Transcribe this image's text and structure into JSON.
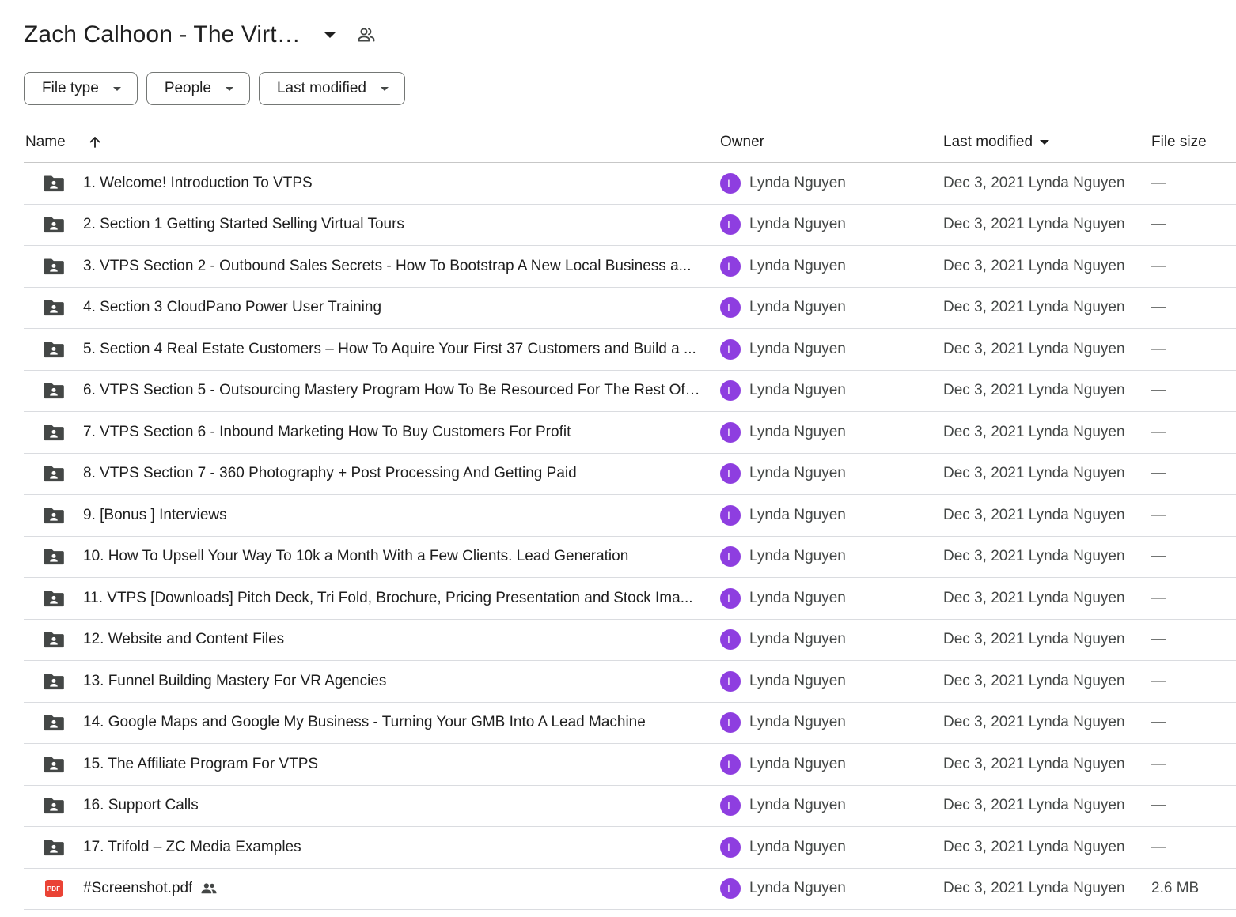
{
  "header": {
    "title": "Zach Calhoon - The Virt…",
    "title_icon": "chevron-down-icon",
    "shared_icon": "shared-with-people-icon"
  },
  "filters": [
    {
      "label": "File type"
    },
    {
      "label": "People"
    },
    {
      "label": "Last modified"
    }
  ],
  "table": {
    "columns": {
      "name": "Name",
      "owner": "Owner",
      "last_modified": "Last modified",
      "file_size": "File size"
    },
    "sort_icon": "arrow-up-icon",
    "avatar_color": "#8e3ee0",
    "rows": [
      {
        "type": "shared-folder",
        "name": "1. Welcome! Introduction To VTPS",
        "avatar": "L",
        "owner": "Lynda Nguyen",
        "modified": "Dec 3, 2021 Lynda Nguyen",
        "size": "—"
      },
      {
        "type": "shared-folder",
        "name": "2. Section 1 Getting Started Selling Virtual Tours",
        "avatar": "L",
        "owner": "Lynda Nguyen",
        "modified": "Dec 3, 2021 Lynda Nguyen",
        "size": "—"
      },
      {
        "type": "shared-folder",
        "name": "3. VTPS Section 2 - Outbound Sales Secrets - How To Bootstrap A New Local Business a...",
        "avatar": "L",
        "owner": "Lynda Nguyen",
        "modified": "Dec 3, 2021 Lynda Nguyen",
        "size": "—"
      },
      {
        "type": "shared-folder",
        "name": "4. Section 3 CloudPano Power User Training",
        "avatar": "L",
        "owner": "Lynda Nguyen",
        "modified": "Dec 3, 2021 Lynda Nguyen",
        "size": "—"
      },
      {
        "type": "shared-folder",
        "name": "5. Section 4 Real Estate Customers – How To Aquire Your First 37 Customers and Build a ...",
        "avatar": "L",
        "owner": "Lynda Nguyen",
        "modified": "Dec 3, 2021 Lynda Nguyen",
        "size": "—"
      },
      {
        "type": "shared-folder",
        "name": "6. VTPS Section 5 - Outsourcing Mastery Program How To Be Resourced For The Rest Of ...",
        "avatar": "L",
        "owner": "Lynda Nguyen",
        "modified": "Dec 3, 2021 Lynda Nguyen",
        "size": "—"
      },
      {
        "type": "shared-folder",
        "name": "7. VTPS Section 6 - Inbound Marketing How To Buy Customers For Profit",
        "avatar": "L",
        "owner": "Lynda Nguyen",
        "modified": "Dec 3, 2021 Lynda Nguyen",
        "size": "—"
      },
      {
        "type": "shared-folder",
        "name": "8. VTPS Section 7 - 360 Photography + Post Processing And Getting Paid",
        "avatar": "L",
        "owner": "Lynda Nguyen",
        "modified": "Dec 3, 2021 Lynda Nguyen",
        "size": "—"
      },
      {
        "type": "shared-folder",
        "name": "9. [Bonus ] Interviews",
        "avatar": "L",
        "owner": "Lynda Nguyen",
        "modified": "Dec 3, 2021 Lynda Nguyen",
        "size": "—"
      },
      {
        "type": "shared-folder",
        "name": "10. How To Upsell Your Way To 10k a Month With a Few Clients. Lead Generation",
        "avatar": "L",
        "owner": "Lynda Nguyen",
        "modified": "Dec 3, 2021 Lynda Nguyen",
        "size": "—"
      },
      {
        "type": "shared-folder",
        "name": "11. VTPS [Downloads] Pitch Deck, Tri Fold, Brochure, Pricing Presentation and Stock Ima...",
        "avatar": "L",
        "owner": "Lynda Nguyen",
        "modified": "Dec 3, 2021 Lynda Nguyen",
        "size": "—"
      },
      {
        "type": "shared-folder",
        "name": "12. Website and Content Files",
        "avatar": "L",
        "owner": "Lynda Nguyen",
        "modified": "Dec 3, 2021 Lynda Nguyen",
        "size": "—"
      },
      {
        "type": "shared-folder",
        "name": "13. Funnel Building Mastery For VR Agencies",
        "avatar": "L",
        "owner": "Lynda Nguyen",
        "modified": "Dec 3, 2021 Lynda Nguyen",
        "size": "—"
      },
      {
        "type": "shared-folder",
        "name": "14. Google Maps and Google My Business - Turning Your GMB Into A Lead Machine",
        "avatar": "L",
        "owner": "Lynda Nguyen",
        "modified": "Dec 3, 2021 Lynda Nguyen",
        "size": "—"
      },
      {
        "type": "shared-folder",
        "name": "15. The Affiliate Program For VTPS",
        "avatar": "L",
        "owner": "Lynda Nguyen",
        "modified": "Dec 3, 2021 Lynda Nguyen",
        "size": "—"
      },
      {
        "type": "shared-folder",
        "name": "16. Support Calls",
        "avatar": "L",
        "owner": "Lynda Nguyen",
        "modified": "Dec 3, 2021 Lynda Nguyen",
        "size": "—"
      },
      {
        "type": "shared-folder",
        "name": "17. Trifold – ZC Media Examples",
        "avatar": "L",
        "owner": "Lynda Nguyen",
        "modified": "Dec 3, 2021 Lynda Nguyen",
        "size": "—"
      },
      {
        "type": "pdf",
        "icon_text": "PDF",
        "name": "#Screenshot.pdf",
        "shared": true,
        "avatar": "L",
        "owner": "Lynda Nguyen",
        "modified": "Dec 3, 2021 Lynda Nguyen",
        "size": "2.6 MB"
      }
    ]
  }
}
